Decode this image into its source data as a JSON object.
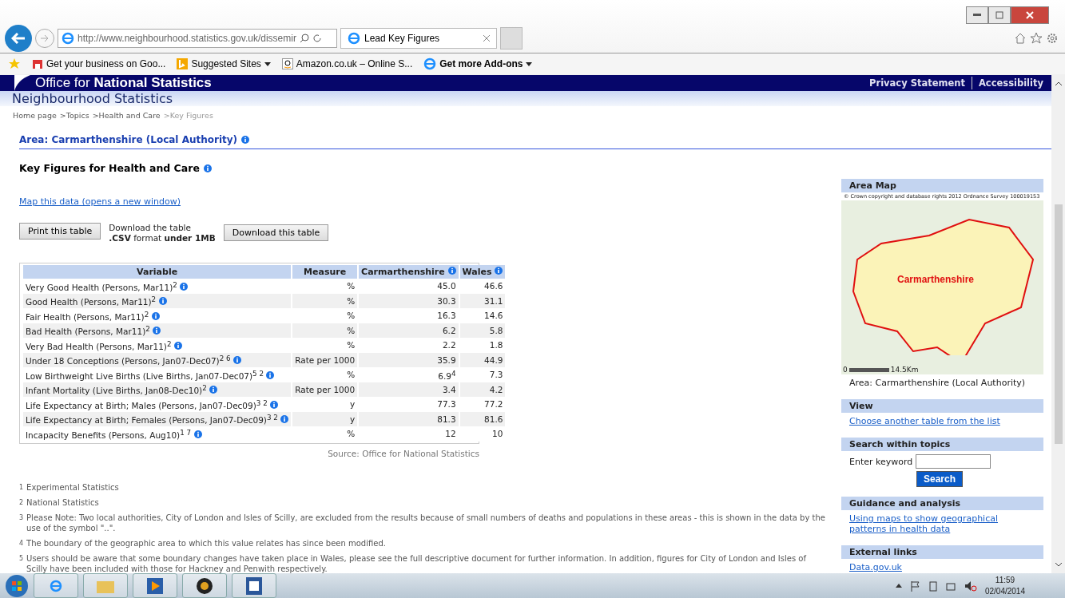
{
  "browser": {
    "address": "http://www.neighbourhood.statistics.gov.uk/dissemir",
    "tab": {
      "title": "Lead Key Figures"
    },
    "favorites": [
      {
        "label": "Get your business on Goo...",
        "kind": "store"
      },
      {
        "label": "Suggested Sites",
        "kind": "menu"
      },
      {
        "label": "Amazon.co.uk – Online S...",
        "kind": "amazon"
      },
      {
        "label": "Get more Add-ons",
        "kind": "addons"
      }
    ]
  },
  "site": {
    "brand_light": "Office for",
    "brand_bold": "National Statistics",
    "header_links": [
      "Privacy Statement",
      "Accessibility"
    ],
    "section_title": "Neighbourhood Statistics",
    "breadcrumb": [
      {
        "label": "Home page",
        "current": false
      },
      {
        "label": ">Topics",
        "current": false
      },
      {
        "label": ">Health and Care",
        "current": false
      },
      {
        "label": ">Key Figures",
        "current": true
      }
    ]
  },
  "area_heading": "Area: Carmarthenshire (Local Authority)",
  "page_title": "Key Figures for Health and Care",
  "map_link": "Map this data (opens a new window)",
  "print_button": "Print this table",
  "download_note": [
    "Download the table",
    "**.CSV** format **under 1MB**"
  ],
  "download_button": "Download this table",
  "table": {
    "columns": [
      {
        "label": "Variable",
        "info": false
      },
      {
        "label": "Measure",
        "info": false
      },
      {
        "label": "Carmarthenshire",
        "info": true
      },
      {
        "label": "Wales",
        "info": true
      }
    ],
    "rows": [
      {
        "variable": "Very Good Health (Persons, Mar11)$^{2}$",
        "measure": "%",
        "area": "45.0",
        "wales": "46.6"
      },
      {
        "variable": "Good Health (Persons, Mar11)$^{2}$",
        "measure": "%",
        "area": "30.3",
        "wales": "31.1"
      },
      {
        "variable": "Fair Health (Persons, Mar11)$^{2}$",
        "measure": "%",
        "area": "16.3",
        "wales": "14.6"
      },
      {
        "variable": "Bad Health (Persons, Mar11)$^{2}$",
        "measure": "%",
        "area": "6.2",
        "wales": "5.8"
      },
      {
        "variable": "Very Bad Health (Persons, Mar11)$^{2}$",
        "measure": "%",
        "area": "2.2",
        "wales": "1.8"
      },
      {
        "variable": "Under 18 Conceptions (Persons, Jan07-Dec07)$^{2 6}$",
        "measure": "Rate per 1000",
        "area": "35.9",
        "wales": "44.9"
      },
      {
        "variable": "Low Birthweight Live Births (Live Births, Jan07-Dec07)$^{5 2}$",
        "measure": "%",
        "area": "6.9$^{4}$",
        "wales": "7.3"
      },
      {
        "variable": "Infant Mortality (Live Births, Jan08-Dec10)$^{2}$",
        "measure": "Rate per 1000",
        "area": "3.4",
        "wales": "4.2"
      },
      {
        "variable": "Life Expectancy at Birth; Males (Persons, Jan07-Dec09)$^{3 2}$",
        "measure": "y",
        "area": "77.3",
        "wales": "77.2"
      },
      {
        "variable": "Life Expectancy at Birth; Females (Persons, Jan07-Dec09)$^{3 2}$",
        "measure": "y",
        "area": "81.3",
        "wales": "81.6"
      },
      {
        "variable": "Incapacity Benefits (Persons, Aug10)$^{1 7}$",
        "measure": "%",
        "area": "12",
        "wales": "10"
      }
    ],
    "source": "Source: Office for National Statistics"
  },
  "footnotes": [
    {
      "mark": "1",
      "text": "Experimental Statistics"
    },
    {
      "mark": "2",
      "text": "National Statistics"
    },
    {
      "mark": "3",
      "text": "Please Note: Two local authorities, City of London and Isles of Scilly, are excluded from the results because of small numbers of deaths and populations in these areas - this is shown in the data by the use of the symbol \"..\"."
    },
    {
      "mark": "4",
      "text": "The boundary of the geographic area to which this value relates has since been modified."
    },
    {
      "mark": "5",
      "text": "Users should be aware that some boundary changes have taken place in Wales, please see the full descriptive document for further information. In addition, figures for City of London and Isles of Scilly have been included with those for Hackney and Penwith respectively."
    }
  ],
  "sidebar": {
    "area_map": {
      "title": "Area Map",
      "copyright": "© Crown copyright and database rights 2012 Ordnance Survey 100019153",
      "map_label": "Carmarthenshire",
      "scale_start": "0",
      "scale_end": "14.5Km",
      "caption": "Area: Carmarthenshire (Local Authority)"
    },
    "view": {
      "title": "View",
      "link": "Choose another table from the list"
    },
    "search": {
      "title": "Search within topics",
      "label": "Enter keyword",
      "button": "Search"
    },
    "guidance": {
      "title": "Guidance and analysis",
      "link": "Using maps to show geographical patterns in health data"
    },
    "external": {
      "title": "External links",
      "link": "Data.gov.uk"
    }
  },
  "taskbar": {
    "time": "11:59",
    "date": "02/04/2014"
  }
}
